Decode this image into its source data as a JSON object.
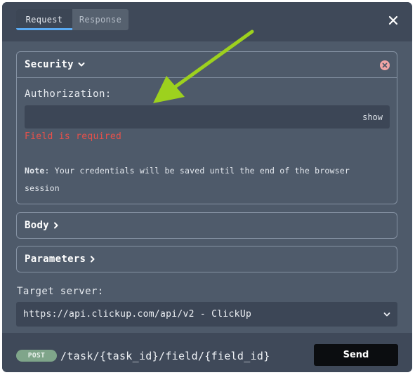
{
  "tabs": [
    {
      "label": "Request",
      "active": true
    },
    {
      "label": "Response",
      "active": false
    }
  ],
  "icons": {
    "close": "close-icon",
    "remove": "remove-circle-icon",
    "chevron_down": "chevron-down-icon",
    "chevron_right": "chevron-right-icon",
    "caret_down": "caret-down-icon",
    "annotation_arrow": "arrow-annotation"
  },
  "colors": {
    "accent": "#5aaaf2",
    "error": "#e8514a",
    "remove_icon": "#f1a5a5",
    "annotation_arrow": "#9dd11e",
    "method_badge": "#7fa58a"
  },
  "security": {
    "title": "Security",
    "auth_label": "Authorization:",
    "auth_value": "",
    "show_label": "show",
    "error": "Field is required",
    "note_label": "Note",
    "note_text": ": Your credentials will be saved until the end of the browser session"
  },
  "body_section": {
    "title": "Body"
  },
  "params_section": {
    "title": "Parameters"
  },
  "target": {
    "label": "Target server:",
    "value": "https://api.clickup.com/api/v2 - ClickUp"
  },
  "footer": {
    "method": "POST",
    "path": "/task/{task_id}/field/{field_id}",
    "send_label": "Send"
  }
}
